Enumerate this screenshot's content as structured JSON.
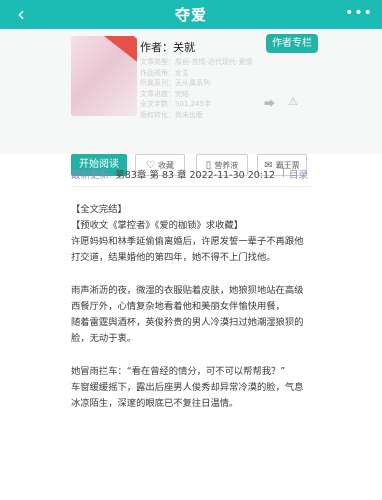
{
  "header": {
    "back_icon": "back-arrow-icon",
    "title": "夺爱",
    "more_icon": "more-dots-icon"
  },
  "book": {
    "author_label": "作者：关就",
    "follow_label": "作者专栏",
    "meta_lines": [
      "文章类型：原创-言情-近代现代-爱情",
      "作品视角：女主",
      "所属系列：无从属系列",
      "文章进度：完结",
      "全文字数：301,245字",
      "版权转化：尚未出版"
    ]
  },
  "actions": {
    "read_label": "开始阅读",
    "collect_label": "收藏",
    "nutrient_label": "营养液",
    "grab_label": "霸王票"
  },
  "update": {
    "label": "最新更新:",
    "text": "第83章 第 83 章 2022-11-30 20:12",
    "separator": "|",
    "dir_label": "目录"
  },
  "content": {
    "paragraphs": [
      "【全文完结】",
      "【预收文《掌控者》《爱的枷锁》求收藏】",
      "许愿妈妈和林季延偷偷离婚后，许愿发誓一辈子不再跟他打交道，结果婚他的第四年，她不得不上门找他。",
      "",
      "雨声淅沥的夜，微湿的衣服贴着皮肤，她狼狈地站在高级西餐厅外，心情复杂地看着他和美丽女伴愉快用餐，",
      "随着雷霆舆酒杯，英俊矜贵的男人冷漠扫过她潮湿狼狈的脸，无动于衷。",
      "",
      "她冒雨拦车：“看在曾经的情分，可不可以帮帮我？”",
      "车窗缓缓摇下，露出后座男人俊秀却异常冷漠的脸，气息冰凉陌生，深邃的眼底已不复往日温情。"
    ]
  }
}
